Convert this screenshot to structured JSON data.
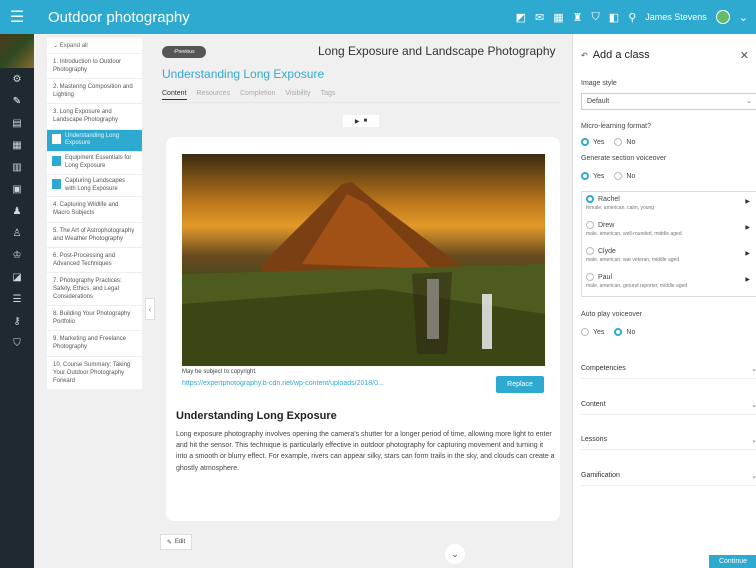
{
  "app": {
    "title": "Outdoor photography",
    "user_name": "James Stevens"
  },
  "outline": {
    "expand_label": "Expand all",
    "items": [
      {
        "label": "1. Introduction to Outdoor Photography"
      },
      {
        "label": "2. Mastering Composition and Lighting"
      },
      {
        "label": "3. Long Exposure and Landscape Photography"
      }
    ],
    "sub_items": [
      {
        "label": "Understanding Long Exposure"
      },
      {
        "label": "Equipment Essentials for Long Exposure"
      },
      {
        "label": "Capturing Landscapes with Long Exposure"
      }
    ],
    "items_after": [
      {
        "label": "4. Capturing Wildlife and Macro Subjects"
      },
      {
        "label": "5. The Art of Astrophotography and Weather Photography"
      },
      {
        "label": "6. Post-Processing and Advanced Techniques"
      },
      {
        "label": "7. Photography Practices: Safety, Ethics, and Legal Considerations"
      },
      {
        "label": "8. Building Your Photography Portfolio"
      },
      {
        "label": "9. Marketing and Freelance Photography"
      },
      {
        "label": "10. Course Summary: Taking Your Outdoor Photography Forward"
      }
    ]
  },
  "main": {
    "prev_label": "Previous",
    "course_title": "Long Exposure and Landscape Photography",
    "section_title": "Understanding Long Exposure",
    "tabs": [
      {
        "label": "Content"
      },
      {
        "label": "Resources"
      },
      {
        "label": "Completion"
      },
      {
        "label": "Visibility"
      },
      {
        "label": "Tags"
      }
    ],
    "copyright": "May be subject to copyright.",
    "image_url": "https://expertphotography.b-cdn.net/wp-content/uploads/2018/0...",
    "replace_label": "Replace",
    "heading": "Understanding Long Exposure",
    "body": "Long exposure photography involves opening the camera's shutter for a longer period of time, allowing more light to enter and hit the sensor. This technique is particularly effective in outdoor photography for capturing movement and turning it into a smooth or blurry effect. For example, rivers can appear silky, stars can form trails in the sky, and clouds can create a ghostly atmosphere.",
    "edit_label": "Edit"
  },
  "panel": {
    "title": "Add a class",
    "image_style_label": "Image style",
    "image_style_value": "Default",
    "micro_label": "Micro-learning format?",
    "voiceover_label": "Generate section voiceover",
    "yes": "Yes",
    "no": "No",
    "voices": [
      {
        "name": "Rachel",
        "desc": "female, american, calm, young"
      },
      {
        "name": "Drew",
        "desc": "male, american, well-rounded, middle aged"
      },
      {
        "name": "Clyde",
        "desc": "male, american, war veteran, middle aged"
      },
      {
        "name": "Paul",
        "desc": "male, american, ground reporter, middle aged"
      }
    ],
    "autoplay_label": "Auto play voiceover",
    "accordions": [
      {
        "label": "Competencies"
      },
      {
        "label": "Content"
      },
      {
        "label": "Lessons"
      },
      {
        "label": "Gamification"
      }
    ],
    "continue_label": "Continue"
  },
  "colors": {
    "accent": "#2eaad1",
    "rail": "#1f2a30"
  }
}
